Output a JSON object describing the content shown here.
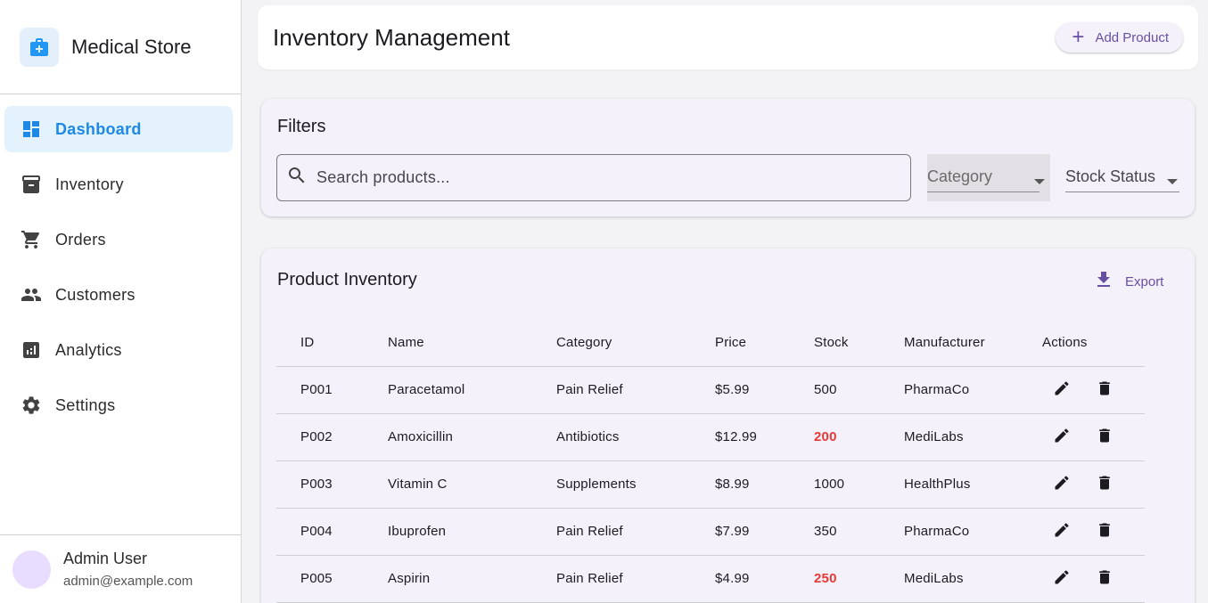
{
  "brand": {
    "title": "Medical Store",
    "icon": "medical-bag-icon",
    "accent": "#2196f3"
  },
  "sidebar": {
    "items": [
      {
        "label": "Dashboard",
        "icon": "dashboard-icon",
        "active": true
      },
      {
        "label": "Inventory",
        "icon": "archive-icon",
        "active": false
      },
      {
        "label": "Orders",
        "icon": "shopping-cart-icon",
        "active": false
      },
      {
        "label": "Customers",
        "icon": "people-icon",
        "active": false
      },
      {
        "label": "Analytics",
        "icon": "analytics-icon",
        "active": false
      },
      {
        "label": "Settings",
        "icon": "gear-icon",
        "active": false
      }
    ]
  },
  "user": {
    "name": "Admin User",
    "email": "admin@example.com"
  },
  "header": {
    "title": "Inventory Management",
    "add_label": "Add Product"
  },
  "filters": {
    "title": "Filters",
    "search_placeholder": "Search products...",
    "category_label": "Category",
    "stock_status_label": "Stock Status"
  },
  "inventory": {
    "title": "Product Inventory",
    "export_label": "Export",
    "columns": [
      "ID",
      "Name",
      "Category",
      "Price",
      "Stock",
      "Manufacturer",
      "Actions"
    ],
    "rows": [
      {
        "id": "P001",
        "name": "Paracetamol",
        "category": "Pain Relief",
        "price": "$5.99",
        "stock": "500",
        "low": false,
        "manufacturer": "PharmaCo"
      },
      {
        "id": "P002",
        "name": "Amoxicillin",
        "category": "Antibiotics",
        "price": "$12.99",
        "stock": "200",
        "low": true,
        "manufacturer": "MediLabs"
      },
      {
        "id": "P003",
        "name": "Vitamin C",
        "category": "Supplements",
        "price": "$8.99",
        "stock": "1000",
        "low": false,
        "manufacturer": "HealthPlus"
      },
      {
        "id": "P004",
        "name": "Ibuprofen",
        "category": "Pain Relief",
        "price": "$7.99",
        "stock": "350",
        "low": false,
        "manufacturer": "PharmaCo"
      },
      {
        "id": "P005",
        "name": "Aspirin",
        "category": "Pain Relief",
        "price": "$4.99",
        "stock": "250",
        "low": true,
        "manufacturer": "MediLabs"
      }
    ]
  },
  "colors": {
    "primary": "#6750a4",
    "active_nav": "#1e88e5",
    "low_stock": "#e53935"
  }
}
